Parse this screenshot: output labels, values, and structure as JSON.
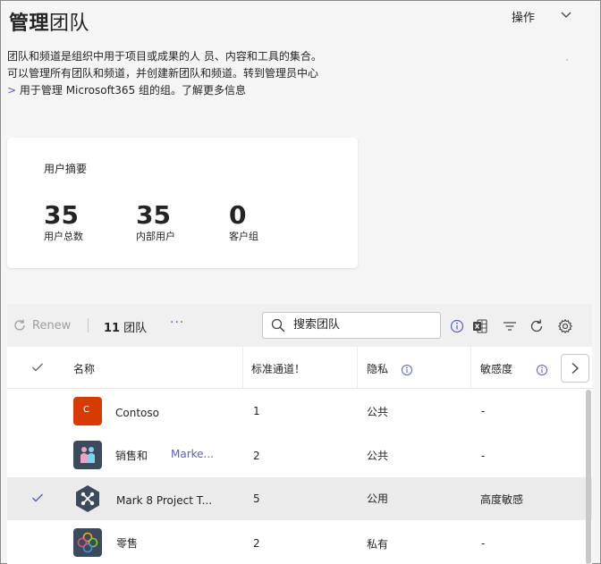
{
  "header": {
    "title_bold": "管理",
    "title_light": "团队",
    "actions_label": "操作"
  },
  "description": {
    "line1": "团队和频道是组织中用于项目或成果的人 员、内容和工具的集合。",
    "line2": "可以管理所有团队和频道，并创建新团队和频道。转到管理员中心",
    "line3_link": ">",
    "line3_text": " 用于管理 Microsoft365 组的组。了解更多信息"
  },
  "summary": {
    "title": "用户摘要",
    "stats": [
      {
        "value": "35",
        "label": "用户总数"
      },
      {
        "value": "35",
        "label": "内部用户"
      },
      {
        "value": "0",
        "label": "客户组"
      }
    ]
  },
  "toolbar": {
    "renew_label": "Renew",
    "team_count": "11",
    "team_count_label": "团队",
    "more_label": "···",
    "search_placeholder": "搜索团队"
  },
  "table": {
    "columns": [
      "名称",
      "标准通道！",
      "隐私",
      "敏感度"
    ],
    "rows": [
      {
        "name": "Contoso",
        "name_extra": "",
        "channels": "1",
        "privacy": "公共",
        "sensitivity": "-",
        "selected": false,
        "avatar_letter": "C",
        "avatar_color": "#d83b01",
        "avatar_icon": "letter-c-icon"
      },
      {
        "name": "销售和",
        "name_extra": "Marke...",
        "channels": "2",
        "privacy": "公共",
        "sensitivity": "-",
        "selected": false,
        "avatar_letter": "",
        "avatar_color": "#3b4a5c",
        "avatar_icon": "people-icon"
      },
      {
        "name": "Mark 8 Project T...",
        "name_extra": "",
        "channels": "5",
        "privacy": "公用",
        "sensitivity": "高度敏感",
        "selected": true,
        "avatar_letter": "",
        "avatar_color": "#3b4a5c",
        "avatar_icon": "network-hexagon-icon"
      },
      {
        "name": "零售",
        "name_extra": "",
        "channels": "2",
        "privacy": "私有",
        "sensitivity": "-",
        "selected": false,
        "avatar_letter": "",
        "avatar_color": "#3b4a5c",
        "avatar_icon": "flower-icon"
      }
    ]
  },
  "colors": {
    "accent": "#5b5fc7",
    "contoso_orange": "#d83b01"
  }
}
